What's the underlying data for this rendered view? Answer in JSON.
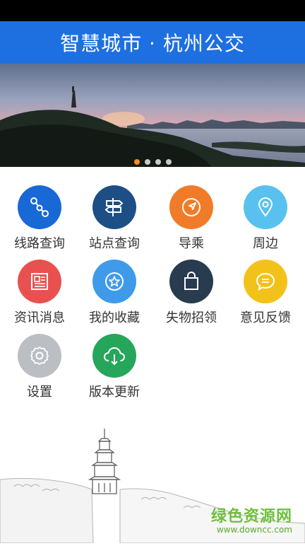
{
  "header": {
    "title": "智慧城市 · 杭州公交"
  },
  "banner": {
    "dots": 4,
    "active_index": 0
  },
  "menu": [
    {
      "label": "线路查询",
      "icon": "route-icon",
      "color": "#1868d6"
    },
    {
      "label": "站点查询",
      "icon": "signpost-icon",
      "color": "#1d4f86"
    },
    {
      "label": "导乘",
      "icon": "navigation-icon",
      "color": "#f07c2a"
    },
    {
      "label": "周边",
      "icon": "location-pin-icon",
      "color": "#59c1ef"
    },
    {
      "label": "资讯消息",
      "icon": "news-icon",
      "color": "#e95150"
    },
    {
      "label": "我的收藏",
      "icon": "star-icon",
      "color": "#3f9bea"
    },
    {
      "label": "失物招领",
      "icon": "bag-icon",
      "color": "#283b4f"
    },
    {
      "label": "意见反馈",
      "icon": "chat-icon",
      "color": "#f3c21a"
    },
    {
      "label": "设置",
      "icon": "gear-icon",
      "color": "#bbbec3"
    },
    {
      "label": "版本更新",
      "icon": "cloud-download-icon",
      "color": "#26a65b"
    }
  ],
  "watermark": {
    "title": "绿色资源网",
    "url": "www.downcc.com"
  }
}
